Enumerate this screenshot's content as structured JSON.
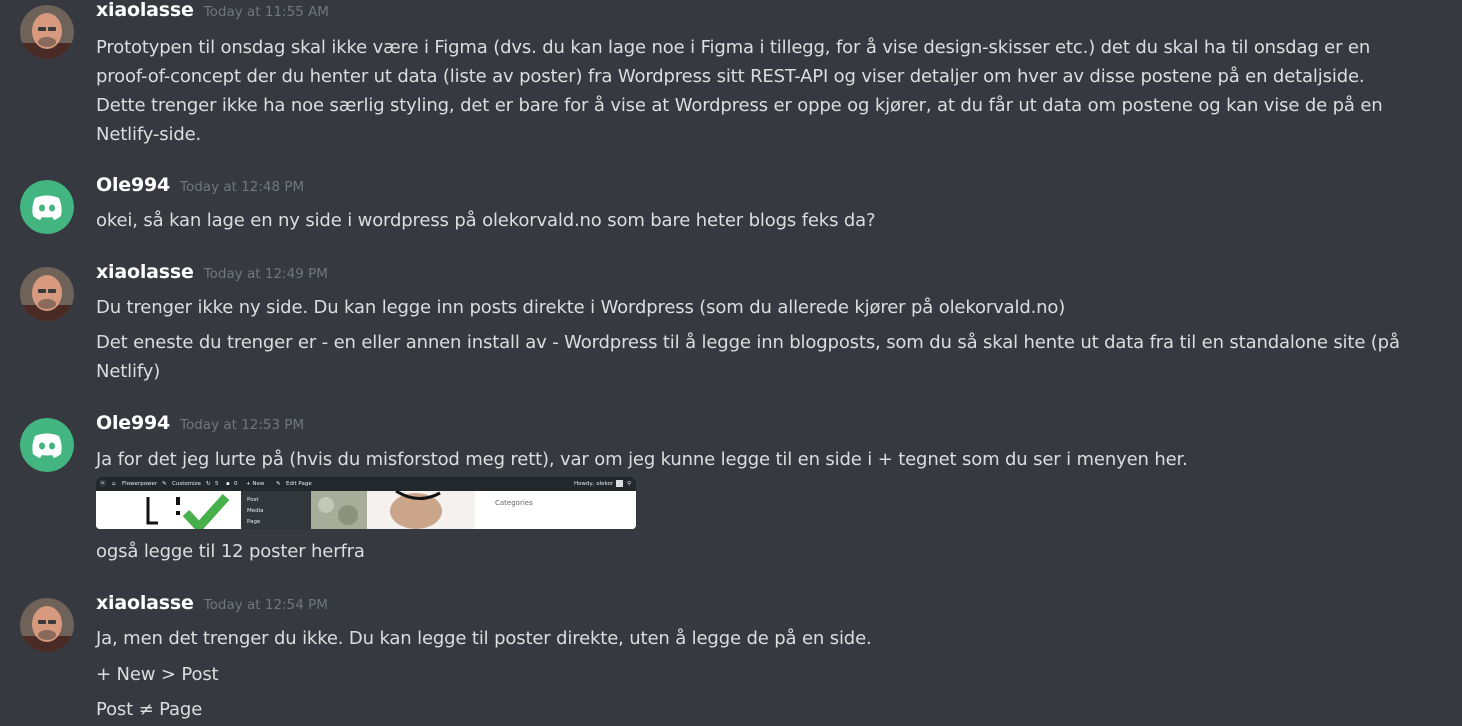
{
  "messages": [
    {
      "author": "xiaolasse",
      "time": "Today at 11:55 AM",
      "lines": [
        "Prototypen til onsdag skal ikke være i Figma (dvs. du kan lage noe i Figma i tillegg, for å vise design-skisser etc.) det du skal ha til onsdag er en",
        "proof-of-concept der du henter ut data (liste av poster) fra Wordpress sitt REST-API og viser detaljer om hver av disse postene på en detaljside.",
        "Dette trenger ikke ha noe særlig styling, det er bare for å vise at Wordpress er oppe og kjører, at du får ut data om postene og kan vise de på en",
        "Netlify-side."
      ]
    },
    {
      "author": "Ole994",
      "time": "Today at 12:48 PM",
      "lines": [
        "okei, så kan lage en ny side i wordpress på olekorvald.no som bare heter blogs feks da?"
      ]
    },
    {
      "author": "xiaolasse",
      "time": "Today at 12:49 PM",
      "lines": [
        "Du trenger ikke ny side. Du kan legge inn posts direkte i Wordpress (som du allerede kjører på olekorvald.no)",
        "Det eneste du trenger er - en eller annen install av - Wordpress til å legge inn blogposts, som du så skal hente ut data fra til en standalone site (på",
        "Netlify)"
      ]
    },
    {
      "author": "Ole994",
      "time": "Today at 12:53 PM",
      "lines": [
        "Ja for det jeg lurte på (hvis du misforstod meg rett), var om jeg kunne legge til en side i + tegnet som du ser i menyen her.",
        "også legge til 12 poster herfra"
      ],
      "attachment": {
        "site_name": "Flowerpower",
        "customize": "Customize",
        "updates": "5",
        "comments": "0",
        "new_label": "+ New",
        "edit_page": "Edit Page",
        "howdy": "Howdy, olekor",
        "menu": [
          "Post",
          "Media",
          "Page"
        ],
        "sidebar_heading": "Categories"
      }
    },
    {
      "author": "xiaolasse",
      "time": "Today at 12:54 PM",
      "lines": [
        "Ja, men det trenger du ikke. Du kan legge til poster direkte, uten å legge de på en side.",
        "+ New > Post",
        "Post ≠ Page"
      ]
    }
  ],
  "colors": {
    "background": "#36393f",
    "text": "#dcddde",
    "username": "#ffffff",
    "timestamp": "#72767d",
    "discord_avatar": "#43b581"
  },
  "icons": {
    "user_avatar": "person-photo-avatar",
    "default_avatar": "discord-logo-icon"
  }
}
